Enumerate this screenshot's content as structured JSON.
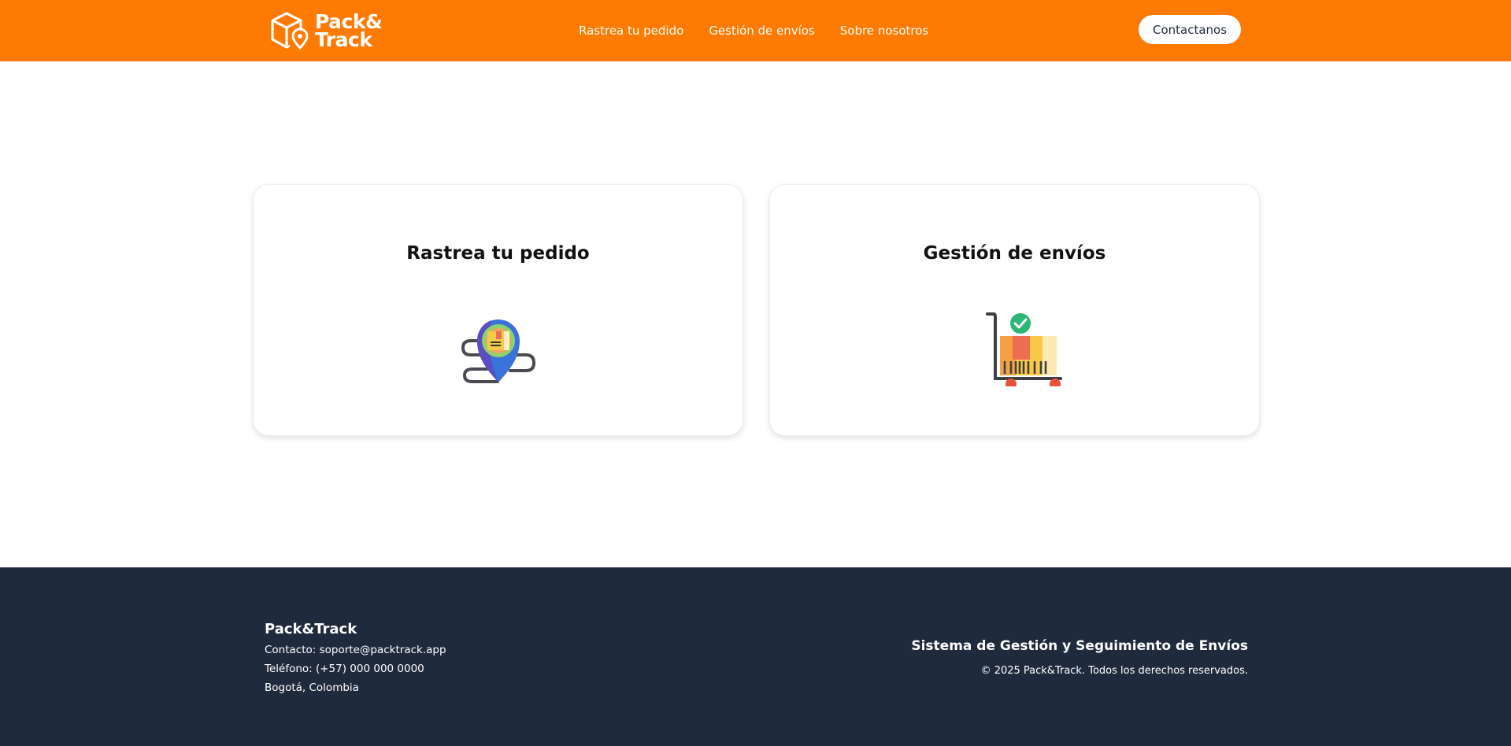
{
  "header": {
    "logo": {
      "line1": "Pack&",
      "line2": "Track",
      "icon": "box-location-logo-icon"
    },
    "nav": [
      {
        "label": "Rastrea tu pedido"
      },
      {
        "label": "Gestión de envíos"
      },
      {
        "label": "Sobre nosotros"
      }
    ],
    "contact_label": "Contactanos",
    "color": "#ff7a00"
  },
  "cards": [
    {
      "title": "Rastrea tu pedido",
      "icon": "package-location-pin-icon"
    },
    {
      "title": "Gestión de envíos",
      "icon": "package-cart-icon"
    }
  ],
  "footer": {
    "brand": "Pack&Track",
    "contact": "Contacto: soporte@packtrack.app",
    "phone": "Teléfono: (+57) 000 000 0000",
    "location": "Bogotá, Colombia",
    "tagline": "Sistema de Gestión y Seguimiento de Envíos",
    "copyright": "© 2025 Pack&Track. Todos los derechos reservados.",
    "color": "#1f2a3d"
  }
}
